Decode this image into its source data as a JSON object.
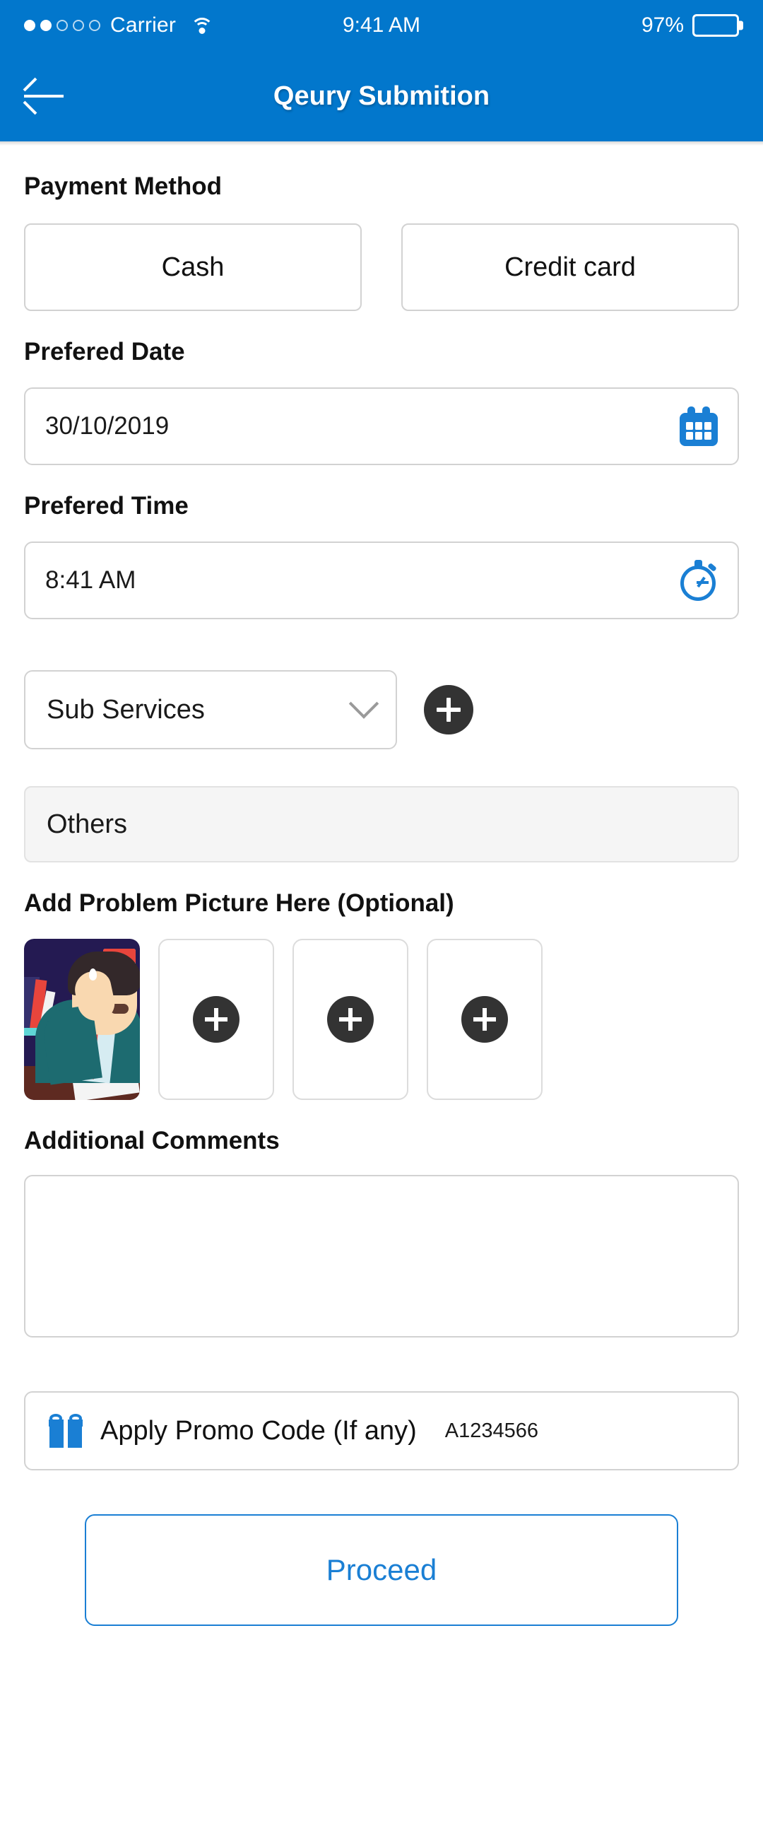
{
  "theme": {
    "brand": "#0277cc",
    "accent_blue": "#1a7fd4",
    "dark": "#333333"
  },
  "status_bar": {
    "carrier": "Carrier",
    "signal_dots_filled": 2,
    "signal_dots_total": 5,
    "wifi_icon": "wifi-icon",
    "time": "9:41 AM",
    "battery_percent": "97%",
    "battery_level": 97
  },
  "nav": {
    "back_icon": "arrow-left-icon",
    "title": "Qeury Submition"
  },
  "payment": {
    "label": "Payment Method",
    "options": [
      {
        "label": "Cash"
      },
      {
        "label": "Credit card"
      }
    ]
  },
  "preferred_date": {
    "label": "Prefered Date",
    "value": "30/10/2019",
    "icon": "calendar-icon"
  },
  "preferred_time": {
    "label": "Prefered Time",
    "value": "8:41 AM",
    "icon": "stopwatch-icon"
  },
  "sub_services": {
    "value": "Sub Services",
    "chevron_icon": "chevron-down-icon",
    "add_icon": "plus-icon"
  },
  "others": {
    "value": "Others"
  },
  "pictures": {
    "label": "Add Problem Picture Here (Optional)",
    "slots": [
      {
        "type": "image",
        "alt": "stressed-businessman-illustration"
      },
      {
        "type": "empty",
        "icon": "plus-icon"
      },
      {
        "type": "empty",
        "icon": "plus-icon"
      },
      {
        "type": "empty",
        "icon": "plus-icon"
      }
    ]
  },
  "comments": {
    "label": "Additional Comments",
    "value": "",
    "placeholder": ""
  },
  "promo": {
    "icon": "gift-icon",
    "label": "Apply Promo Code (If any)",
    "code": "A1234566"
  },
  "proceed": {
    "label": "Proceed"
  }
}
